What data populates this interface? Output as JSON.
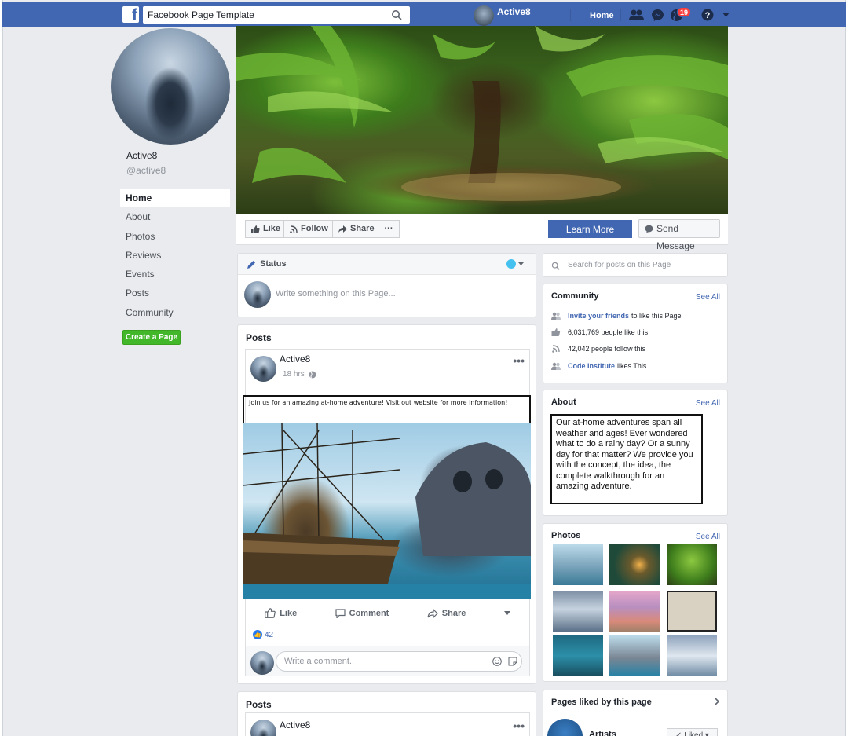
{
  "topbar": {
    "logo": "f",
    "search_value": "Facebook Page Template",
    "profile_name": "Active8",
    "home_label": "Home",
    "notification_count": "19"
  },
  "left": {
    "page_name": "Active8",
    "page_handle": "@active8",
    "nav": [
      "Home",
      "About",
      "Photos",
      "Reviews",
      "Events",
      "Posts",
      "Community"
    ],
    "create_page": "Create a Page"
  },
  "actions": {
    "like": "Like",
    "follow": "Follow",
    "share": "Share",
    "more": "···",
    "learn_more": "Learn More",
    "send_message": "Send Message"
  },
  "status": {
    "title": "Status",
    "placeholder": "Write something on this Page..."
  },
  "posts": {
    "title": "Posts",
    "post": {
      "author": "Active8",
      "time": "18 hrs",
      "text": "Join us for an amazing at-home adventure! Visit out website for more information!",
      "like_label": "Like",
      "comment_label": "Comment",
      "share_label": "Share",
      "reaction_count": "42",
      "comment_placeholder": "Write a comment.."
    },
    "second_title": "Posts",
    "second_author": "Active8"
  },
  "right": {
    "search_placeholder": "Search for posts on this Page",
    "community": {
      "title": "Community",
      "see_all": "See All",
      "invite_link": "Invite your friends",
      "invite_rest": "to like this Page",
      "likes": "6,031,769 people like this",
      "follows": "42,042 people follow this",
      "ci_link": "Code Institute",
      "ci_rest": "likes This"
    },
    "about": {
      "title": "About",
      "see_all": "See All",
      "text": "Our at-home adventures span all weather and ages! Ever wondered what to do a rainy day? Or a sunny day for that matter? We provide you with the concept, the idea, the complete walkthrough for an amazing adventure."
    },
    "photos": {
      "title": "Photos",
      "see_all": "See All"
    },
    "liked": {
      "title": "Pages liked by this page",
      "first_page": "Artists",
      "liked_button": "✓ Liked ▾"
    }
  },
  "colors": {
    "brand": "#4267b2",
    "background": "#e9ebee",
    "create_green": "#42b72a",
    "badge_red": "#fa3e3e"
  }
}
